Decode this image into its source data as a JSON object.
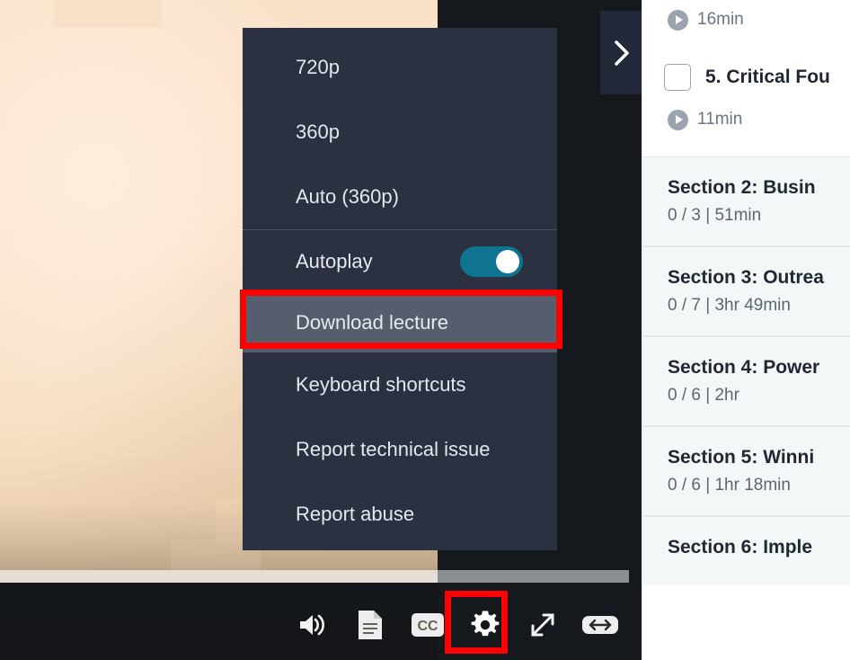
{
  "player": {
    "seekbar": {
      "name": "video-progress-bar",
      "buffered_pct": 70
    },
    "controls": [
      {
        "icon": "volume-icon",
        "label": "Volume"
      },
      {
        "icon": "transcript-icon",
        "label": "Transcript"
      },
      {
        "icon": "closed-captions-icon",
        "label": "CC"
      },
      {
        "icon": "gear-icon",
        "label": "Settings",
        "highlighted": true
      },
      {
        "icon": "fullscreen-expand-icon",
        "label": "Fullscreen"
      },
      {
        "icon": "resize-width-icon",
        "label": "Resize"
      }
    ]
  },
  "settings_menu": {
    "quality_options": [
      {
        "label": "720p"
      },
      {
        "label": "360p"
      },
      {
        "label": "Auto (360p)"
      }
    ],
    "autoplay": {
      "label": "Autoplay",
      "enabled": true
    },
    "download": {
      "label": "Download lecture",
      "highlighted": true
    },
    "other_items": [
      {
        "label": "Keyboard shortcuts"
      },
      {
        "label": "Report technical issue"
      },
      {
        "label": "Report abuse"
      }
    ]
  },
  "sidebar": {
    "collapse_button": {
      "icon": "chevron-right-icon",
      "label": ">"
    },
    "top_lecture_duration": "16min",
    "lecture": {
      "checkbox_checked": false,
      "title": "5. Critical Fou",
      "duration": "11min"
    },
    "sections": [
      {
        "title": "Section 2: Busin",
        "meta": "0 / 3 | 51min"
      },
      {
        "title": "Section 3: Outrea",
        "meta": "0 / 7 | 3hr 49min"
      },
      {
        "title": "Section 4: Power",
        "meta": "0 / 6 | 2hr"
      },
      {
        "title": "Section 5: Winni",
        "meta": "0 / 6 | 1hr 18min"
      },
      {
        "title": "Section 6: Imple",
        "meta": ""
      }
    ]
  },
  "colors": {
    "menu_bg": "#2b3141",
    "menu_highlight_bg": "#565d6c",
    "annotation_red": "#ff0000",
    "toggle_on": "#0e7490",
    "player_bg": "#15181c",
    "section_bg": "#f4f7f8"
  }
}
